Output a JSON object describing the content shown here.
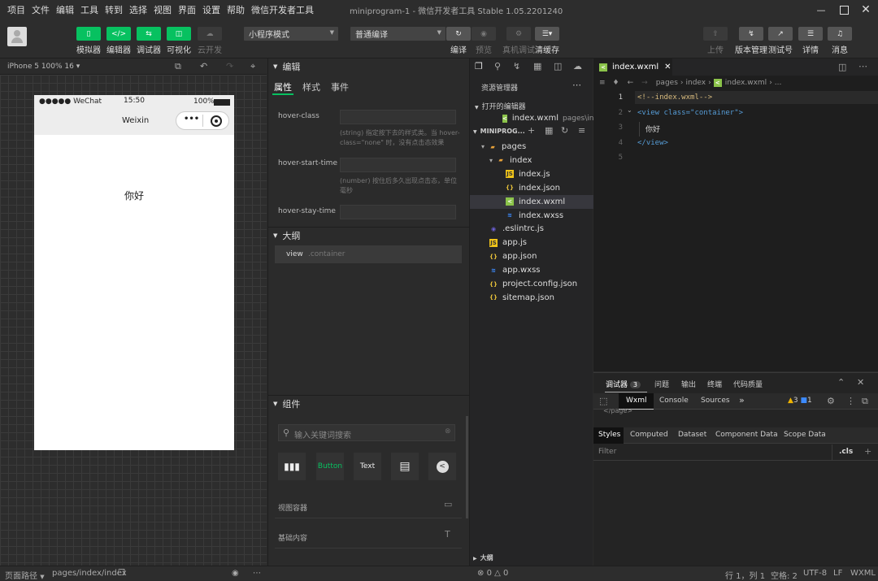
{
  "menubar": {
    "items": [
      "项目",
      "文件",
      "编辑",
      "工具",
      "转到",
      "选择",
      "视图",
      "界面",
      "设置",
      "帮助",
      "微信开发者工具"
    ],
    "title": "miniprogram-1 - 微信开发者工具 Stable 1.05.2201240"
  },
  "toolbar": {
    "simulator": "模拟器",
    "editor": "编辑器",
    "debugger": "调试器",
    "visual": "可视化",
    "cloud": "云开发",
    "mode_select": "小程序模式",
    "compile_select": "普通编译",
    "compile": "编译",
    "preview": "预览",
    "real_debug": "真机调试",
    "clear_cache": "清缓存",
    "upload": "上传",
    "version": "版本管理",
    "test": "测试号",
    "details": "详情",
    "messages": "消息"
  },
  "sim": {
    "device": "iPhone 5 100% 16 ▾",
    "carrier": "●●●●● WeChat",
    "time": "15:50",
    "battery": "100%",
    "nav_title": "Weixin",
    "content": "你好"
  },
  "edit_panel": {
    "title": "编辑",
    "tabs": [
      "属性",
      "样式",
      "事件"
    ],
    "props": [
      {
        "name": "hover-class",
        "desc": "(string) 指定按下去的样式类。当 hover-class=\"none\" 时，没有点击态效果"
      },
      {
        "name": "hover-start-time",
        "desc": "(number) 按住后多久出现点击态，单位毫秒"
      },
      {
        "name": "hover-stay-time",
        "desc": ""
      }
    ],
    "outline_title": "大纲",
    "outline_item": "view",
    "outline_class": ".container",
    "components_title": "组件",
    "search_placeholder": "输入关键词搜索",
    "comp_labels": [
      "Button",
      "Text"
    ],
    "cat1": "视图容器",
    "cat2": "基础内容"
  },
  "explorer": {
    "title": "资源管理器",
    "open_editors": "打开的编辑器",
    "open_file": "index.wxml",
    "open_path": "pages\\index",
    "project": "MINIPROG...",
    "tree": [
      {
        "name": "pages",
        "type": "folder",
        "indent": 1
      },
      {
        "name": "index",
        "type": "folder",
        "indent": 2
      },
      {
        "name": "index.js",
        "type": "js",
        "indent": 3
      },
      {
        "name": "index.json",
        "type": "json",
        "indent": 3
      },
      {
        "name": "index.wxml",
        "type": "wxml",
        "indent": 3,
        "selected": true
      },
      {
        "name": "index.wxss",
        "type": "wxss",
        "indent": 3
      },
      {
        "name": ".eslintrc.js",
        "type": "eslint",
        "indent": 1
      },
      {
        "name": "app.js",
        "type": "js",
        "indent": 1
      },
      {
        "name": "app.json",
        "type": "json",
        "indent": 1
      },
      {
        "name": "app.wxss",
        "type": "wxss",
        "indent": 1
      },
      {
        "name": "project.config.json",
        "type": "json",
        "indent": 1
      },
      {
        "name": "sitemap.json",
        "type": "json",
        "indent": 1
      }
    ],
    "outline": "大纲"
  },
  "editor": {
    "tab": "index.wxml",
    "breadcrumb": [
      "pages",
      "index",
      "index.wxml",
      "..."
    ],
    "lines": [
      {
        "n": "1",
        "text": "<!--index.wxml-->",
        "color": "#d7ba7d"
      },
      {
        "n": "2",
        "text": "<view class=\"container\">",
        "color": "#569cd6"
      },
      {
        "n": "3",
        "text": "你好",
        "color": "#d4d4d4"
      },
      {
        "n": "4",
        "text": "</view>",
        "color": "#569cd6"
      },
      {
        "n": "5",
        "text": "",
        "color": "#d4d4d4"
      }
    ]
  },
  "devtools": {
    "tabs": [
      "调试器",
      "问题",
      "输出",
      "终端",
      "代码质量"
    ],
    "badge": "3",
    "panels": [
      "Wxml",
      "Console",
      "Sources"
    ],
    "warn": "3",
    "info": "1",
    "peek": "</page>",
    "sub_tabs": [
      "Styles",
      "Computed",
      "Dataset",
      "Component Data",
      "Scope Data"
    ],
    "filter": "Filter",
    "cls": ".cls"
  },
  "status": {
    "path_label": "页面路径",
    "path": "pages/index/index",
    "errors": "0",
    "warnings": "0",
    "cursor": "行 1，列 1",
    "spaces": "空格: 2",
    "encoding": "UTF-8",
    "eol": "LF",
    "lang": "WXML"
  }
}
